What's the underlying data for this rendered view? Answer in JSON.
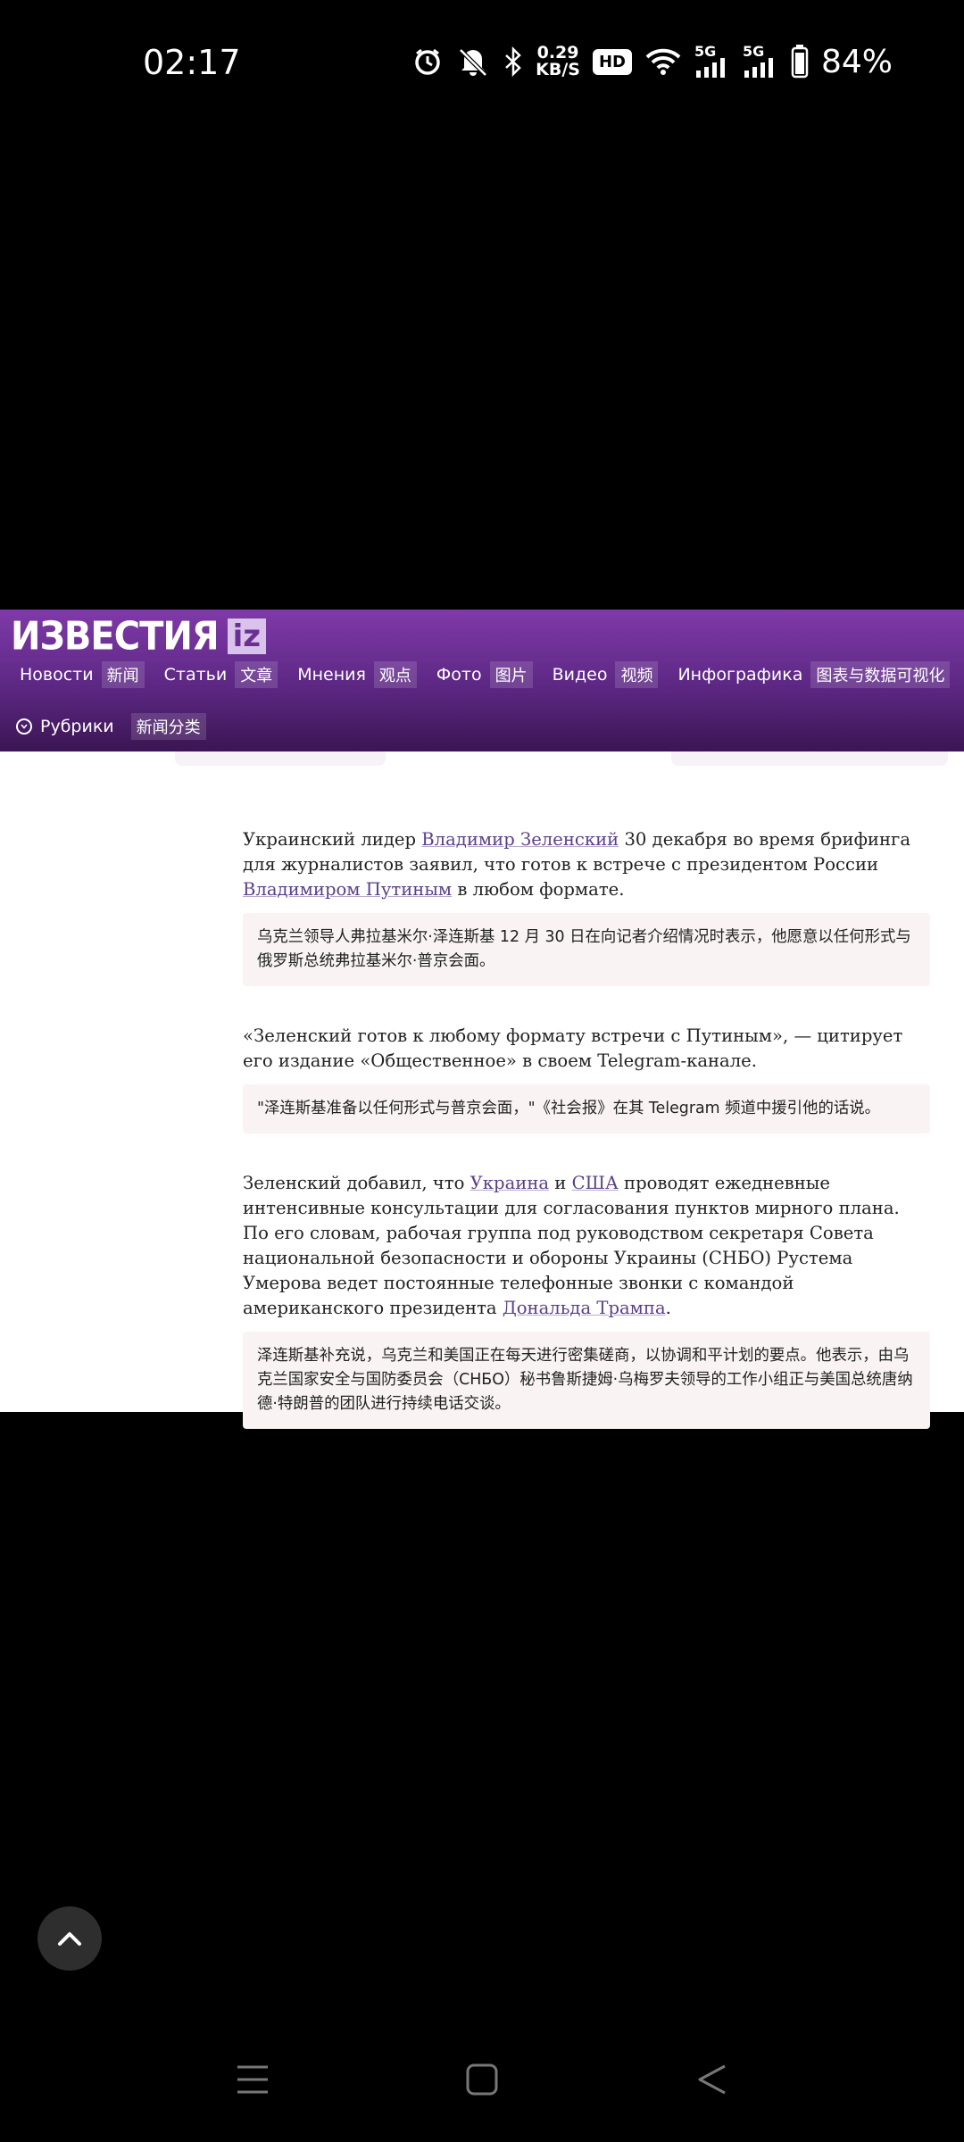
{
  "status_bar": {
    "time": "02:17",
    "net_speed_value": "0.29",
    "net_speed_unit": "KB/S",
    "hd_label": "HD",
    "signal1_label": "5G",
    "signal2_label": "5G",
    "battery": "84%",
    "icons": [
      "alarm-icon",
      "mute-icon",
      "bluetooth-icon",
      "wifi-icon",
      "signal-icon",
      "battery-icon"
    ]
  },
  "header": {
    "logo_text": "ИЗВЕСТИЯ",
    "logo_badge": "iz",
    "nav": [
      {
        "ru": "Новости",
        "zh": "新闻"
      },
      {
        "ru": "Статьи",
        "zh": "文章"
      },
      {
        "ru": "Мнения",
        "zh": "观点"
      },
      {
        "ru": "Фото",
        "zh": "图片"
      },
      {
        "ru": "Видео",
        "zh": "视频"
      },
      {
        "ru": "Инфографика",
        "zh": "图表与数据可视化"
      }
    ],
    "rubrics": {
      "ru": "Рубрики",
      "zh": "新闻分类"
    },
    "colors": {
      "top": "#7f3aa8",
      "bottom": "#3b1553"
    }
  },
  "article": {
    "p1": {
      "t1": "Украинский лидер ",
      "link1": "Владимир Зеленский",
      "t2": " 30 декабря во время брифинга для журналистов заявил, что готов к встрече с президентом России ",
      "link2": "Владимиром Путиным",
      "t3": " в любом формате."
    },
    "p1_zh": "乌克兰领导人弗拉基米尔·泽连斯基 12 月 30 日在向记者介绍情况时表示，他愿意以任何形式与俄罗斯总统弗拉基米尔·普京会面。",
    "p2": "«Зеленский готов к любому формату встречи с Путиным», — цитирует его издание «Общественное» в своем Telegram-канале.",
    "p2_zh": "\"泽连斯基准备以任何形式与普京会面，\"《社会报》在其 Telegram 频道中援引他的话说。",
    "p3": {
      "t1": "Зеленский добавил, что ",
      "link1": "Украина",
      "t2": " и ",
      "link2": "США",
      "t3": " проводят ежедневные интенсивные консультации для согласования пунктов мирного плана. По его словам, рабочая группа под руководством секретаря Совета национальной безопасности и обороны Украины (СНБО) Рустема Умерова ведет постоянные телефонные звонки с командой американского президента ",
      "link3": "Дональда Трампа",
      "t4": "."
    },
    "p3_zh": "泽连斯基补充说，乌克兰和美国正在每天进行密集磋商，以协调和平计划的要点。他表示，由乌克兰国家安全与国防委员会（СНБО）秘书鲁斯捷姆·乌梅罗夫领导的工作小组正与美国总统唐纳德·特朗普的团队进行持续电话交谈。"
  },
  "controls": {
    "scroll_top_icon": "chevron-up-icon",
    "nav_bar_icons": [
      "menu-icon",
      "home-icon",
      "back-icon"
    ]
  }
}
